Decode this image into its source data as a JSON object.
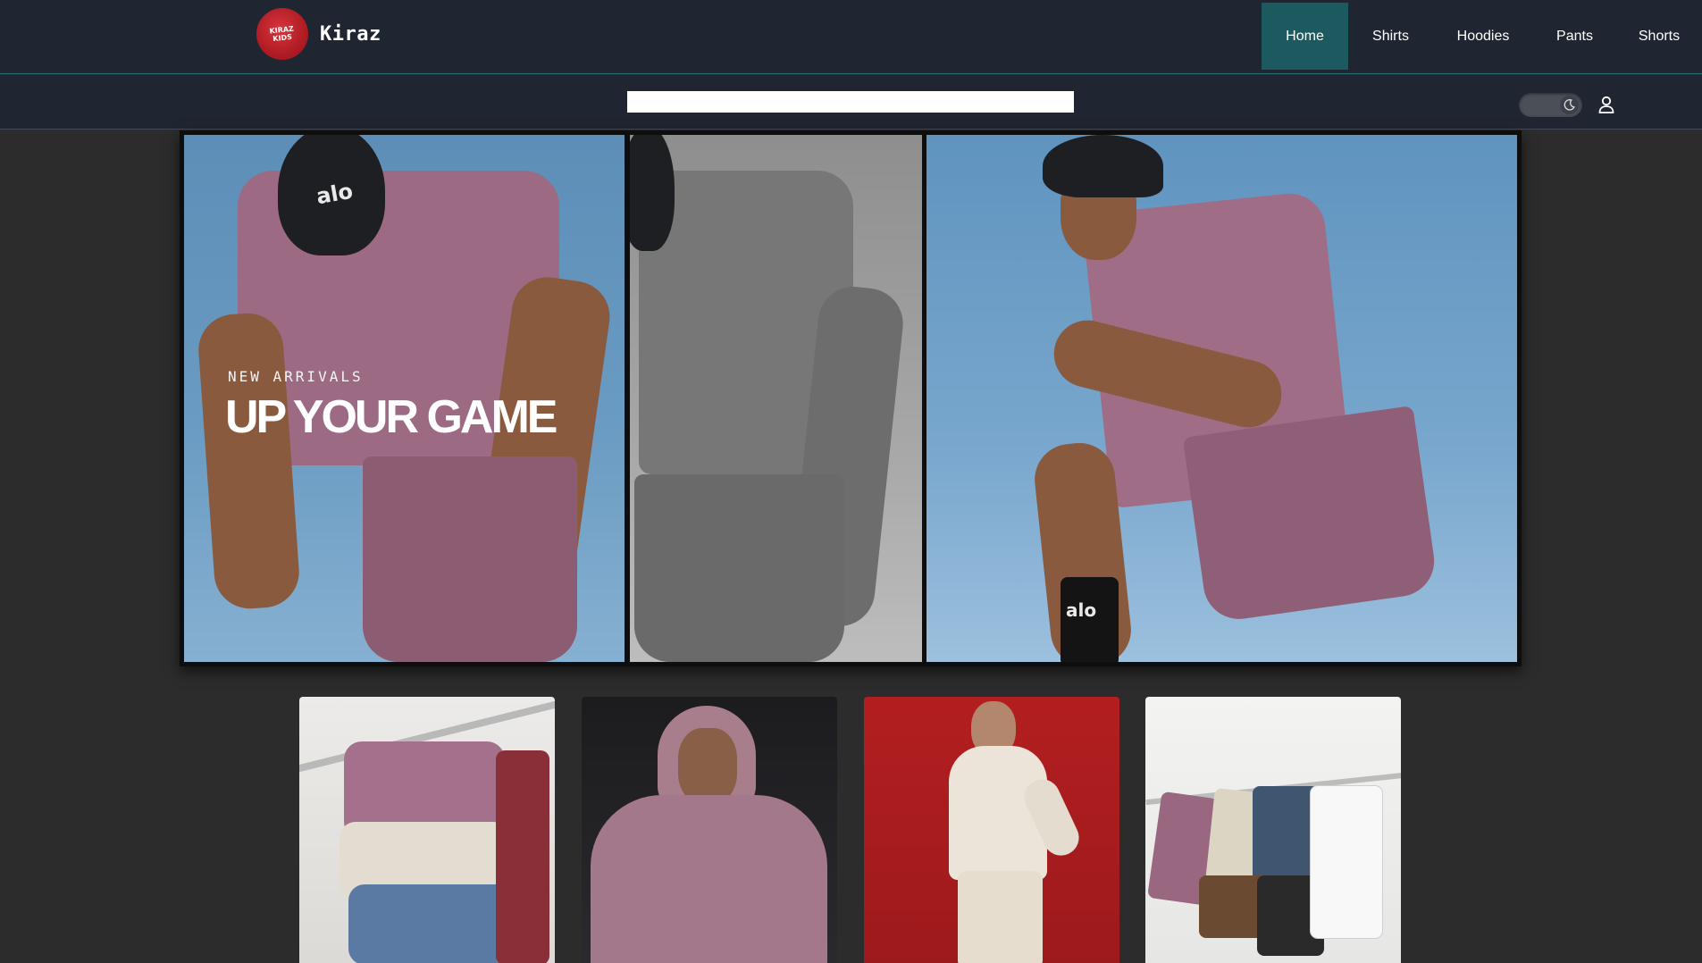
{
  "header": {
    "logo_alt_text": "Kiraz Kids",
    "brand_name": "Kiraz",
    "nav": [
      {
        "label": "Home",
        "active": true
      },
      {
        "label": "Shirts",
        "active": false
      },
      {
        "label": "Hoodies",
        "active": false
      },
      {
        "label": "Pants",
        "active": false
      },
      {
        "label": "Shorts",
        "active": false
      }
    ]
  },
  "subbar": {
    "search_value": "",
    "search_placeholder": "",
    "theme_toggle_icon": "moon-icon",
    "account_icon": "user-icon"
  },
  "hero": {
    "kicker": "NEW ARRIVALS",
    "headline": "UP YOUR GAME",
    "cap_logo": "alo",
    "sock_logo": "alo"
  },
  "products": [
    {
      "name": "shirts-category-card",
      "image": "folded t-shirts on rack"
    },
    {
      "name": "hoodies-category-card",
      "image": "man in pink hoodie"
    },
    {
      "name": "pants-category-card",
      "image": "man in cream hoodie and cargo pants"
    },
    {
      "name": "shorts-category-card",
      "image": "shorts hanging on rack"
    }
  ],
  "colors": {
    "header_bg": "#202631",
    "nav_active_bg": "#1c5a5f",
    "page_bg": "#2c2c2c",
    "brand_red": "#b01c24"
  }
}
